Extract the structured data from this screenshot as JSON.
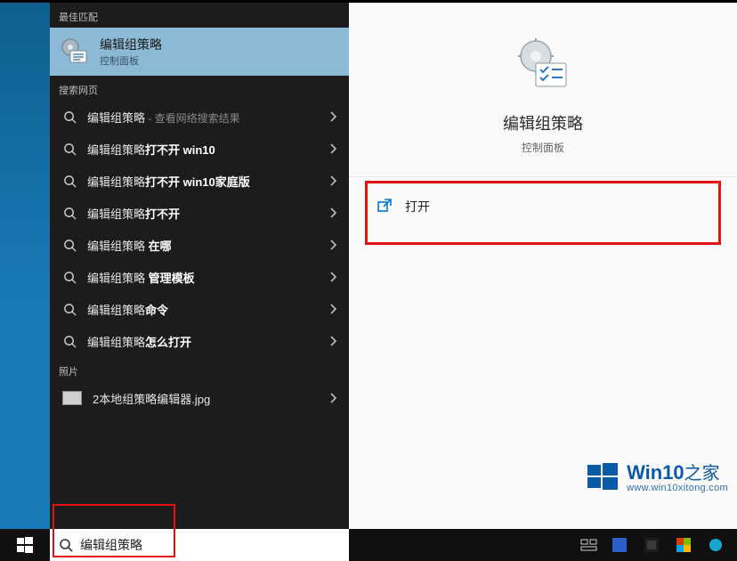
{
  "search": {
    "best_match_header": "最佳匹配",
    "web_header": "搜索网页",
    "photo_header": "照片",
    "input_value": "编辑组策略"
  },
  "best_match": {
    "title": "编辑组策略",
    "subtitle": "控制面板"
  },
  "web_results": [
    {
      "prefix": "编辑组策略",
      "bold": "",
      "suffix": " - 查看网络搜索结果"
    },
    {
      "prefix": "编辑组策略",
      "bold": "打不开 win10",
      "suffix": ""
    },
    {
      "prefix": "编辑组策略",
      "bold": "打不开 win10家庭版",
      "suffix": ""
    },
    {
      "prefix": "编辑组策略",
      "bold": "打不开",
      "suffix": ""
    },
    {
      "prefix": "编辑组策略 ",
      "bold": "在哪",
      "suffix": ""
    },
    {
      "prefix": "编辑组策略 ",
      "bold": "管理模板",
      "suffix": ""
    },
    {
      "prefix": "编辑组策略",
      "bold": "命令",
      "suffix": ""
    },
    {
      "prefix": "编辑组策略",
      "bold": "怎么打开",
      "suffix": ""
    }
  ],
  "photo_result": {
    "label": "2本地组策略编辑器.jpg"
  },
  "preview": {
    "title": "编辑组策略",
    "subtitle": "控制面板",
    "action_open": "打开"
  },
  "watermark": {
    "brand": "Win10",
    "brand_suffix": "之家",
    "url": "www.win10xitong.com"
  },
  "colors": {
    "highlight_red": "#e11313",
    "accent_blue": "#0078d7",
    "selection_blue": "#8bb9d6"
  }
}
